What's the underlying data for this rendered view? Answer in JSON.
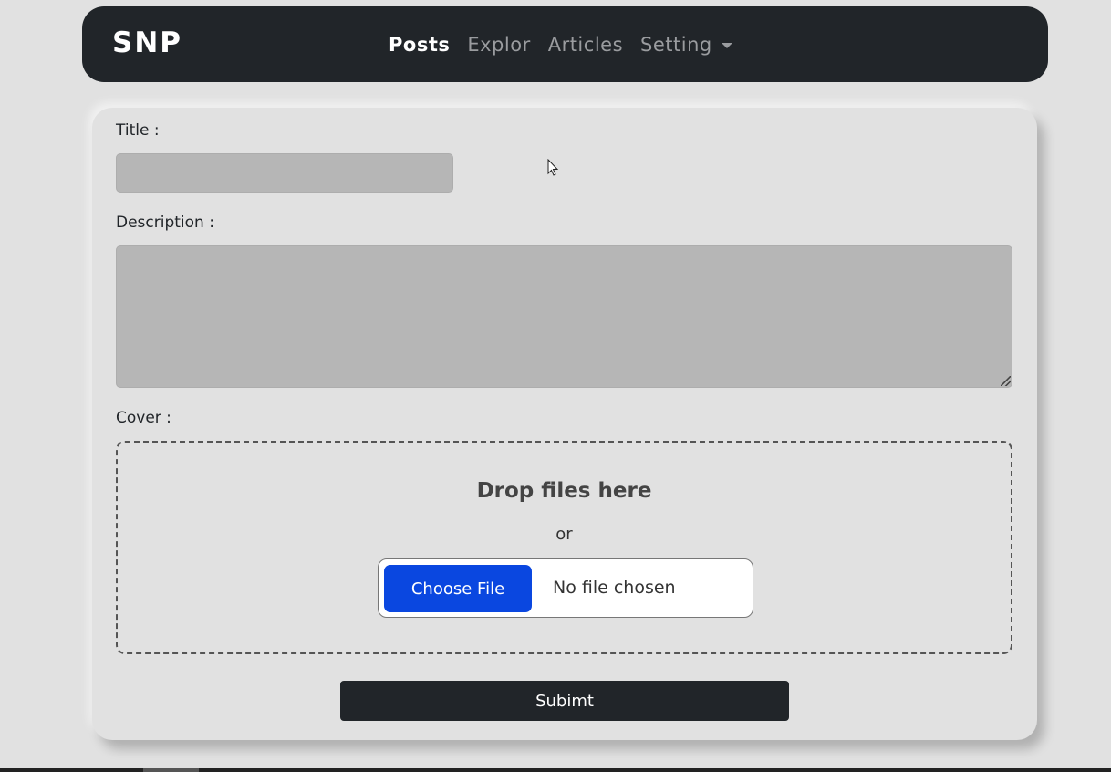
{
  "navbar": {
    "brand": "SNP",
    "links": [
      {
        "label": "Posts",
        "active": true
      },
      {
        "label": "Explor",
        "active": false
      },
      {
        "label": "Articles",
        "active": false
      },
      {
        "label": "Setting",
        "active": false,
        "dropdown": true
      }
    ]
  },
  "form": {
    "title_label": "Title :",
    "title_value": "",
    "description_label": "Description :",
    "description_value": "",
    "cover_label": "Cover :",
    "dropzone": {
      "title": "Drop files here",
      "or": "or",
      "choose_button": "Choose File",
      "file_status": "No file chosen"
    },
    "submit_label": "Subimt"
  },
  "colors": {
    "navbar_bg": "#212529",
    "page_bg": "#e1e1e1",
    "input_bg": "#b6b6b6",
    "choose_button_bg": "#0a47e0",
    "submit_bg": "#212529"
  }
}
